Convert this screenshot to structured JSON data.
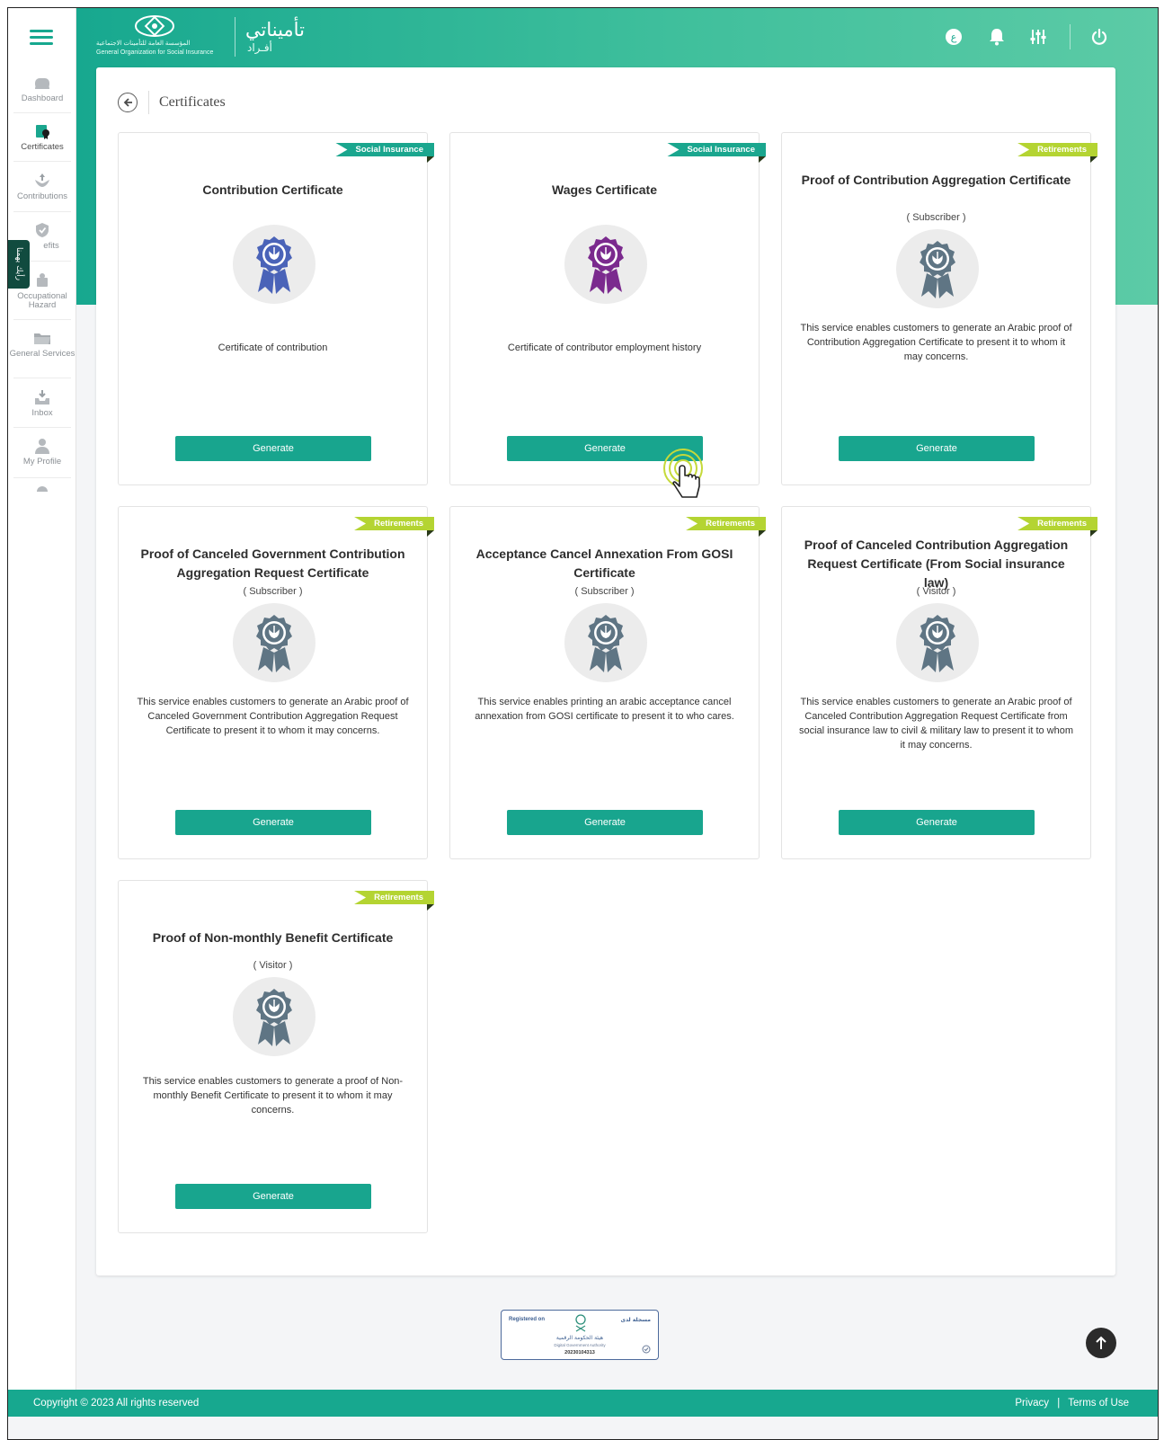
{
  "header": {
    "org_name_ar": "المؤسسة العامة للتأمينات الاجتماعية",
    "org_name_en": "General Organization for Social Insurance",
    "app_title": "تأميناتي",
    "app_subtitle": "أفـراد",
    "icons": [
      "language-icon",
      "bell-icon",
      "settings-sliders-icon",
      "power-icon"
    ],
    "language_label": "ع"
  },
  "sidebar": {
    "items": [
      {
        "label": "Dashboard",
        "icon": "dashboard-icon"
      },
      {
        "label": "Certificates",
        "icon": "certificate-icon",
        "active": true
      },
      {
        "label": "Contributions",
        "icon": "contributions-icon"
      },
      {
        "label": "efits",
        "icon": "benefits-icon"
      },
      {
        "label": "Occupational Hazard",
        "icon": "hazard-icon"
      },
      {
        "label": "General Services",
        "icon": "folder-icon"
      },
      {
        "label": "Inbox",
        "icon": "inbox-icon"
      },
      {
        "label": "My Profile",
        "icon": "profile-icon"
      }
    ],
    "arabic_tab": "رأيك يهمنا"
  },
  "page": {
    "title": "Certificates"
  },
  "cards": [
    {
      "tag": "Social Insurance",
      "tag_type": "si",
      "title": "Contribution Certificate",
      "subtitle": "",
      "description": "Certificate of contribution",
      "button": "Generate",
      "medal_color": "#4a63b8"
    },
    {
      "tag": "Social Insurance",
      "tag_type": "si",
      "title": "Wages Certificate",
      "subtitle": "",
      "description": "Certificate of contributor employment history",
      "button": "Generate",
      "medal_color": "#7b2a8e"
    },
    {
      "tag": "Retirements",
      "tag_type": "ret",
      "title": "Proof of Contribution Aggregation Certificate",
      "subtitle": "( Subscriber )",
      "description": "This service enables customers to generate an Arabic proof of Contribution Aggregation Certificate to present it to whom it may concerns.",
      "button": "Generate",
      "medal_color": "#5f7584"
    },
    {
      "tag": "Retirements",
      "tag_type": "ret",
      "title": "Proof of Canceled Government Contribution Aggregation Request Certificate",
      "subtitle": "( Subscriber )",
      "description": "This service enables customers to generate an Arabic proof of Canceled Government Contribution Aggregation Request Certificate to present it to whom it may concerns.",
      "button": "Generate",
      "medal_color": "#5f7584"
    },
    {
      "tag": "Retirements",
      "tag_type": "ret",
      "title": "Acceptance Cancel Annexation From GOSI Certificate",
      "subtitle": "( Subscriber )",
      "description": "This service enables printing an arabic acceptance cancel annexation from GOSI certificate to present it to who cares.",
      "button": "Generate",
      "medal_color": "#5f7584"
    },
    {
      "tag": "Retirements",
      "tag_type": "ret",
      "title": "Proof of Canceled Contribution Aggregation Request Certificate (From Social insurance law)",
      "subtitle": "( Visitor )",
      "description": "This service enables customers to generate an Arabic proof of Canceled Contribution Aggregation Request Certificate from social insurance law to civil & military law to present it to whom it may concerns.",
      "button": "Generate",
      "medal_color": "#5f7584"
    },
    {
      "tag": "Retirements",
      "tag_type": "ret",
      "title": "Proof of Non-monthly Benefit Certificate",
      "subtitle": "( Visitor )",
      "description": "This service enables customers to generate a proof of Non-monthly Benefit Certificate to present it to whom it may concerns.",
      "button": "Generate",
      "medal_color": "#5f7584"
    }
  ],
  "badge": {
    "left": "Registered on",
    "right": "مسجلة لدى",
    "name_ar": "هيئة الحكومة الرقمية",
    "name_en": "Digital Government Authority",
    "id": "20230104313"
  },
  "footer": {
    "copyright": "Copyright © 2023 All rights reserved",
    "privacy": "Privacy",
    "separator": "|",
    "terms": "Terms of Use"
  },
  "colors": {
    "primary": "#17a88f",
    "retirement_tag": "#b4d432",
    "button": "#18a58e"
  }
}
